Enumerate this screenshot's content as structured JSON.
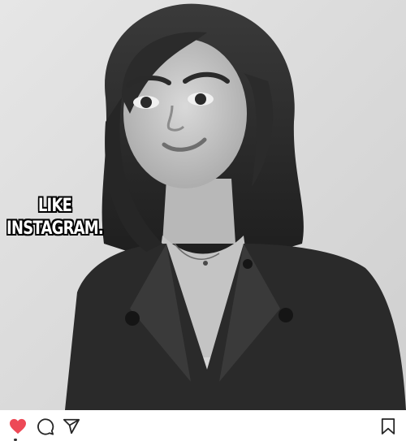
{
  "post": {
    "caption_lines": [
      "LIKE",
      "INSTAGRAM."
    ],
    "photo_style": "grayscale portrait"
  },
  "actions": {
    "like": {
      "icon": "heart-icon",
      "state": "liked",
      "color": "#ed4956"
    },
    "comment": {
      "icon": "comment-icon"
    },
    "share": {
      "icon": "paper-plane-icon"
    },
    "save": {
      "icon": "bookmark-icon"
    }
  }
}
